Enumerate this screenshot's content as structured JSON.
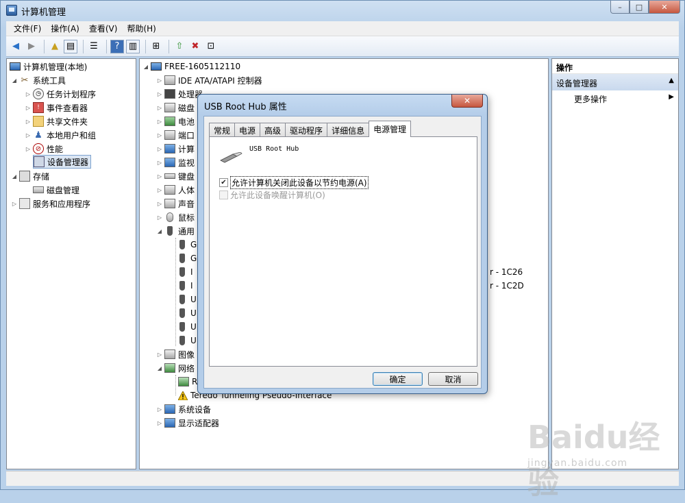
{
  "window": {
    "title": "计算机管理",
    "controls": {
      "minimize": "–",
      "maximize": "□",
      "close": "✕"
    }
  },
  "menu": [
    "文件(F)",
    "操作(A)",
    "查看(V)",
    "帮助(H)"
  ],
  "left_tree": {
    "root": "计算机管理(本地)",
    "system_tools": "系统工具",
    "items": [
      "任务计划程序",
      "事件查看器",
      "共享文件夹",
      "本地用户和组",
      "性能",
      "设备管理器"
    ],
    "storage": "存储",
    "disk_mgmt": "磁盘管理",
    "services": "服务和应用程序"
  },
  "device_tree": {
    "computer": "FREE-1605112110",
    "ide": "IDE ATA/ATAPI 控制器",
    "processor": "处理器",
    "disk": "磁盘",
    "battery": "电池",
    "port": "端口",
    "computer_node": "计算",
    "monitor": "监视",
    "keyboard": "键盘",
    "hid": "人体",
    "sound": "声音",
    "mouse": "鼠标",
    "usb": "通用",
    "usb_children": [
      "G",
      "G",
      "I",
      "I",
      "U",
      "U",
      "U",
      "U"
    ],
    "usb_suffix_1": "r - 1C26",
    "usb_suffix_2": "r - 1C2D",
    "imaging": "图像",
    "network": "网络",
    "network_child": "R",
    "teredo": "Teredo Tunneling Pseudo-Interface",
    "system_devices": "系统设备",
    "display": "显示适配器"
  },
  "actions": {
    "header": "操作",
    "section": "设备管理器",
    "more": "更多操作"
  },
  "dialog": {
    "title": "USB Root Hub 属性",
    "close": "✕",
    "tabs": [
      "常规",
      "电源",
      "高级",
      "驱动程序",
      "详细信息",
      "电源管理"
    ],
    "active_tab": "电源管理",
    "device_name": "USB Root Hub",
    "option_1": "允许计算机关闭此设备以节约电源(A)",
    "option_1_checked": true,
    "option_2": "允许此设备唤醒计算机(O)",
    "option_2_checked": false,
    "ok": "确定",
    "cancel": "取消"
  },
  "watermark": {
    "text": "Baidu经验",
    "sub": "jingyan.baidu.com"
  }
}
